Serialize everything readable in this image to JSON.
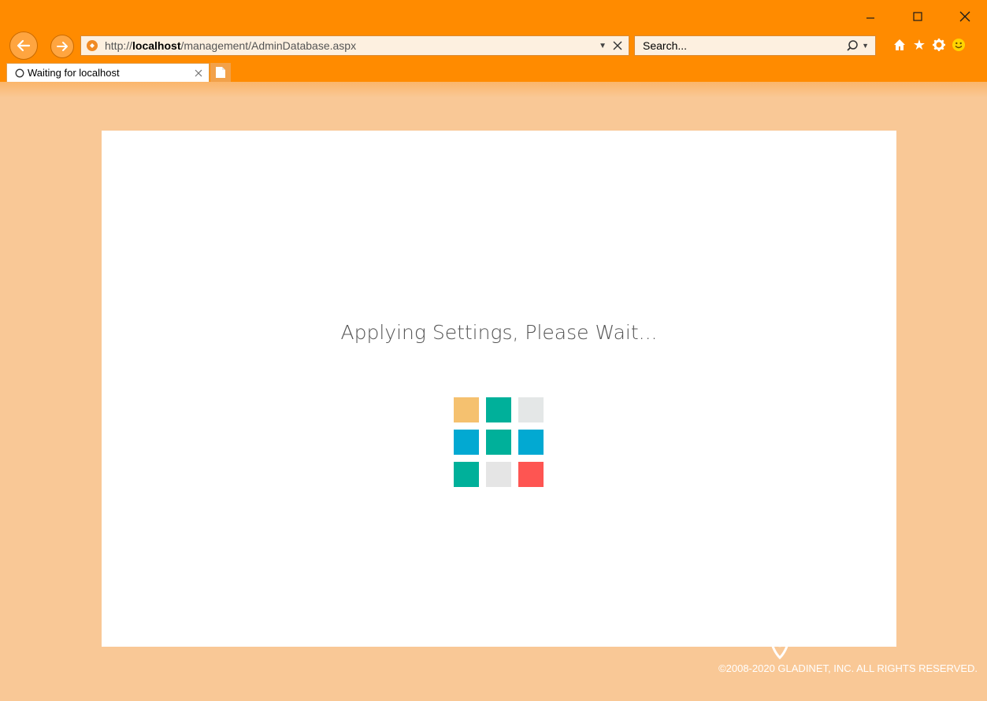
{
  "browser": {
    "address_url_prefix": "http://",
    "address_url_host": "localhost",
    "address_url_path": "/management/AdminDatabase.aspx",
    "search_placeholder": "Search...",
    "tab_title": "Waiting for localhost",
    "window_controls": [
      "minimize-icon",
      "maximize-icon",
      "close-icon"
    ],
    "toolbar_icons": [
      "home-icon",
      "favorites-star-icon",
      "settings-gear-icon",
      "feedback-smiley-icon"
    ]
  },
  "page": {
    "status_message": "Applying Settings, Please Wait...",
    "spinner_colors": [
      [
        "#f5c16f",
        "#00b09a",
        "#e4e7e7"
      ],
      [
        "#02a9d2",
        "#00b09a",
        "#02a9d2"
      ],
      [
        "#00b09a",
        "#e5e5e5",
        "#fe5552"
      ]
    ],
    "brand_logo": "triofox",
    "copyright": "©2008-2020 GLADINET, INC. ALL RIGHTS RESERVED."
  },
  "colors": {
    "chrome": "#ff8b00",
    "page_background": "#f9c896",
    "card": "#ffffff"
  }
}
